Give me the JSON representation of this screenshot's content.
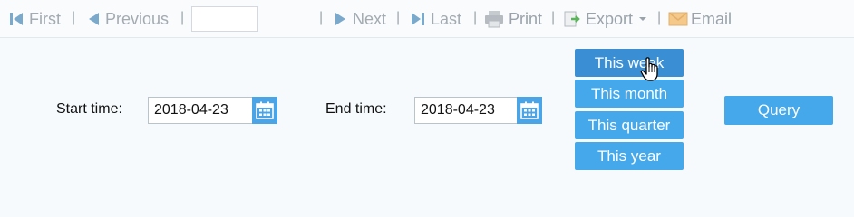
{
  "toolbar": {
    "first": "First",
    "previous": "Previous",
    "page_value": "",
    "next": "Next",
    "last": "Last",
    "print": "Print",
    "export": "Export",
    "email": "Email",
    "separator": "|"
  },
  "filters": {
    "start_label": "Start time:",
    "start_value": "2018-04-23",
    "end_label": "End time:",
    "end_value": "2018-04-23"
  },
  "quick_ranges": {
    "this_week": "This week",
    "this_month": "This month",
    "this_quarter": "This quarter",
    "this_year": "This year"
  },
  "query_label": "Query",
  "colors": {
    "accent": "#45a8ea",
    "accent_active": "#3a8fd4",
    "toolbar_text": "#9aa3ab"
  }
}
